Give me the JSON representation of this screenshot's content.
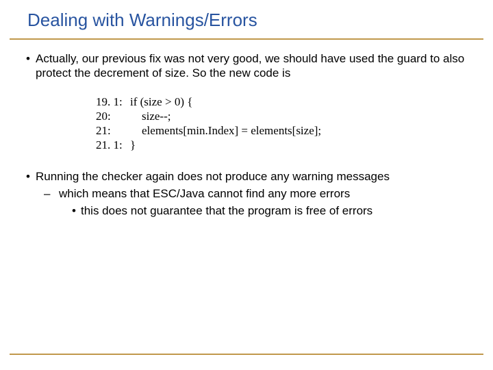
{
  "title": "Dealing with Warnings/Errors",
  "bullets": {
    "b1": "Actually, our previous fix was not very good, we should have used the guard to also protect the decrement of size. So the new code is",
    "b2": "Running the checker again does not produce any warning messages",
    "b2_1": "which means that ESC/Java cannot find any more errors",
    "b2_1_1": "this does not guarantee that the program is free of errors"
  },
  "code": [
    {
      "ln": "19. 1:",
      "ct": "if (size > 0) {"
    },
    {
      "ln": "20:",
      "ct": "    size--;"
    },
    {
      "ln": "21:",
      "ct": "    elements[min.Index] = elements[size];"
    },
    {
      "ln": "21. 1:",
      "ct": "}"
    }
  ],
  "marks": {
    "dot": "•",
    "dash": "–"
  }
}
